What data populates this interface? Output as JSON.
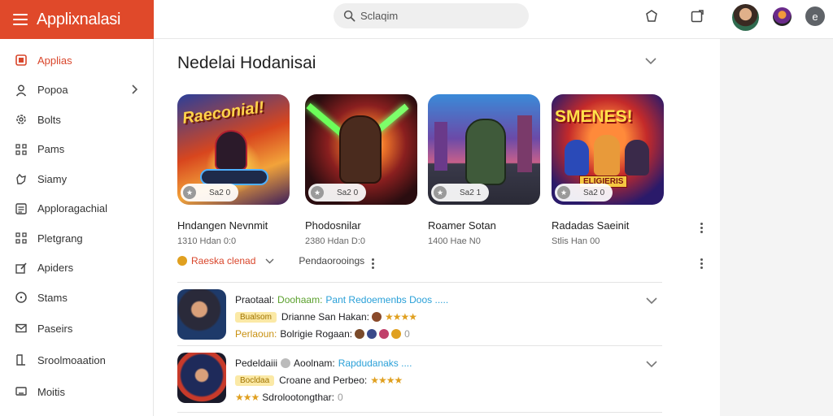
{
  "app": {
    "title": "Applixnalasi"
  },
  "search": {
    "placeholder": "Sclaqim"
  },
  "sidebar": {
    "items": [
      {
        "label": "Applias",
        "icon": "grid-icon",
        "active": true
      },
      {
        "label": "Popoa",
        "icon": "person-icon",
        "chevron": true
      },
      {
        "label": "Bolts",
        "icon": "gear-icon"
      },
      {
        "label": "Pams",
        "icon": "apps-icon"
      },
      {
        "label": "Siamy",
        "icon": "hand-icon"
      },
      {
        "label": "Apploragachial",
        "icon": "list-icon"
      },
      {
        "label": "Pletgrang",
        "icon": "apps-icon"
      },
      {
        "label": "Apiders",
        "icon": "edit-icon"
      },
      {
        "label": "Stams",
        "icon": "clock-icon"
      },
      {
        "label": "Paseirs",
        "icon": "mail-icon"
      },
      {
        "label": "Sroolmoaation",
        "icon": "file-icon"
      },
      {
        "label": "Moitis",
        "icon": "monitor-icon"
      }
    ]
  },
  "section": {
    "title": "Nedelai Hodanisai"
  },
  "cards": [
    {
      "name": "Hndangen Nevnmit",
      "meta": "1310 Hdan 0:0",
      "rating": "Sa2 0",
      "art_text": "Raeconial!"
    },
    {
      "name": "Phodosnilar",
      "meta": "2380 Hdan D:0",
      "rating": "Sa2 0"
    },
    {
      "name": "Roamer Sotan",
      "meta": "1400 Hae N0",
      "rating": "Sa2 1"
    },
    {
      "name": "Radadas Saeinit",
      "meta": "Stlis Han 00",
      "rating": "Sa2 0",
      "art_text": "SMENES!",
      "art_subtext": "ELIGIERIS"
    }
  ],
  "actions": {
    "primary": "Raeska clenad",
    "secondary": "Pendaorooings"
  },
  "list": [
    {
      "title": "Praotaal:",
      "title_green": "Doohaam:",
      "title_blue": "Pant Redoemenbs Doos .....",
      "tag": "Bualsom",
      "line2": "Drianne San Hakan:",
      "line3_label": "Perlaoun:",
      "line3": "Bolrigie Rogaan:",
      "line3_tail": "0"
    },
    {
      "title": "Pedeldaiii",
      "title_mid": "Aoolnam:",
      "title_blue": "Rapdudanaks ....",
      "tag": "Bocldaa",
      "line2": "Croane and Perbeo:",
      "line3": "Sdrolootongthar:",
      "line3_tail": "0"
    }
  ],
  "colors": {
    "brand": "#e0492a",
    "accent_active": "#d9462b",
    "star": "#e0a020",
    "link": "#29a0d8",
    "tag_bg": "#fbe9a6"
  }
}
